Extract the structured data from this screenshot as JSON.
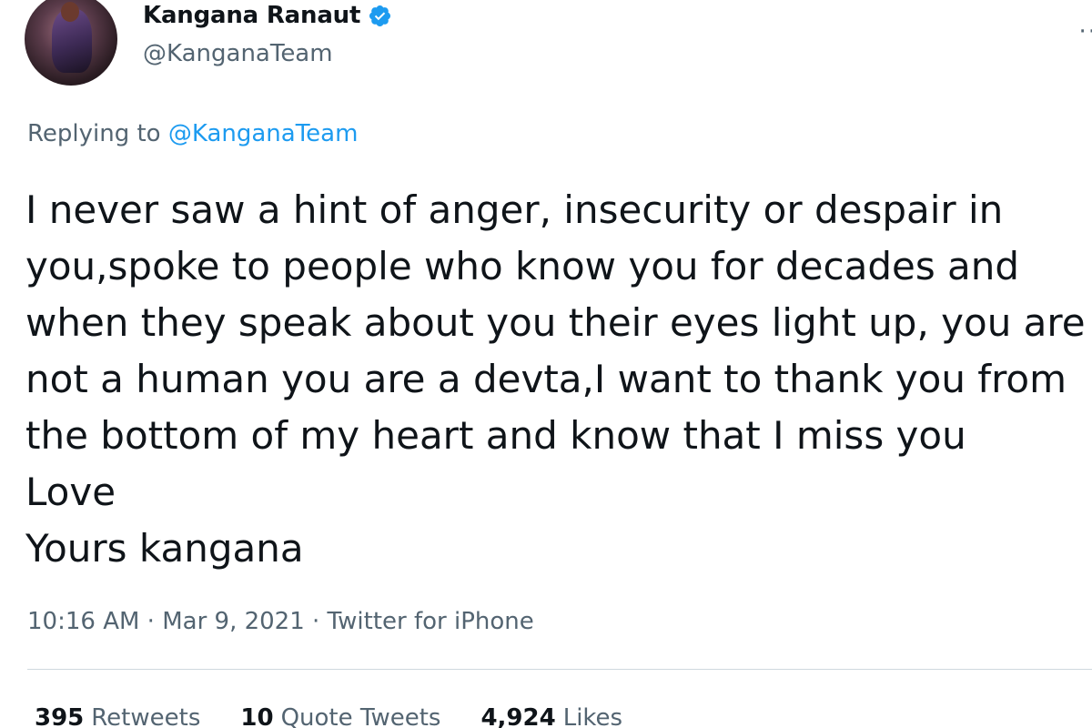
{
  "author": {
    "display_name": "Kangana Ranaut",
    "handle": "@KanganaTeam",
    "verified_icon": "verified-badge-icon",
    "avatar": "profile-photo"
  },
  "reply": {
    "prefix": "Replying to",
    "mention": "@KanganaTeam"
  },
  "tweet": {
    "text": "I never saw a hint of anger, insecurity or despair in\nyou,spoke to people who know you for decades and\nwhen they speak about you their eyes light up, you are\nnot a human you are a devta,I want to thank you from\nthe bottom of my heart and know that I miss you\nLove\nYours kangana"
  },
  "meta": {
    "line": "10:16 AM · Mar 9, 2021 · Twitter for iPhone"
  },
  "stats": {
    "retweets": {
      "count": "395",
      "label": "Retweets"
    },
    "quote_tweets": {
      "count": "10",
      "label": "Quote Tweets"
    },
    "likes": {
      "count": "4,924",
      "label": "Likes"
    }
  },
  "colors": {
    "accent": "#1d9bf0",
    "secondary_text": "#536471",
    "primary_text": "#0f1419"
  }
}
